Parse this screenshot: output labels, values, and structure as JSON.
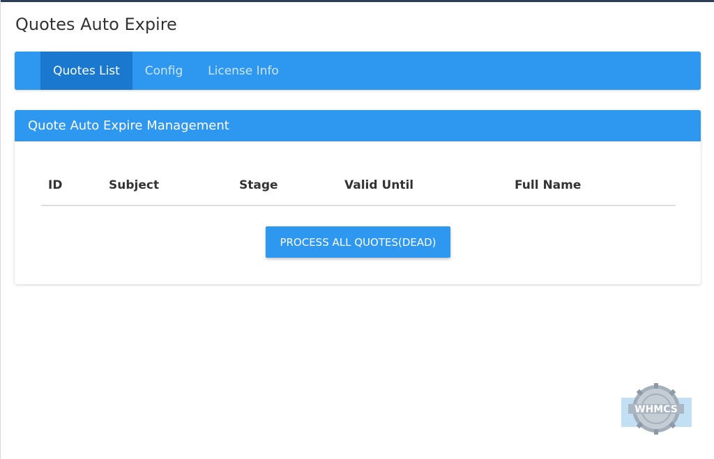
{
  "page": {
    "title": "Quotes Auto Expire"
  },
  "tabs": [
    {
      "label": "Quotes List",
      "active": true
    },
    {
      "label": "Config",
      "active": false
    },
    {
      "label": "License Info",
      "active": false
    }
  ],
  "panel": {
    "title": "Quote Auto Expire Management",
    "columns": [
      "ID",
      "Subject",
      "Stage",
      "Valid Until",
      "Full Name"
    ],
    "rows": [],
    "process_button_label": "PROCESS ALL QUOTES(DEAD)"
  },
  "watermark": {
    "text": "WHMCS",
    "icon": "whmcs-gear-logo"
  },
  "colors": {
    "accent": "#2e97ef",
    "active_tab": "#1b78cf",
    "top_border": "#2c3e57"
  }
}
